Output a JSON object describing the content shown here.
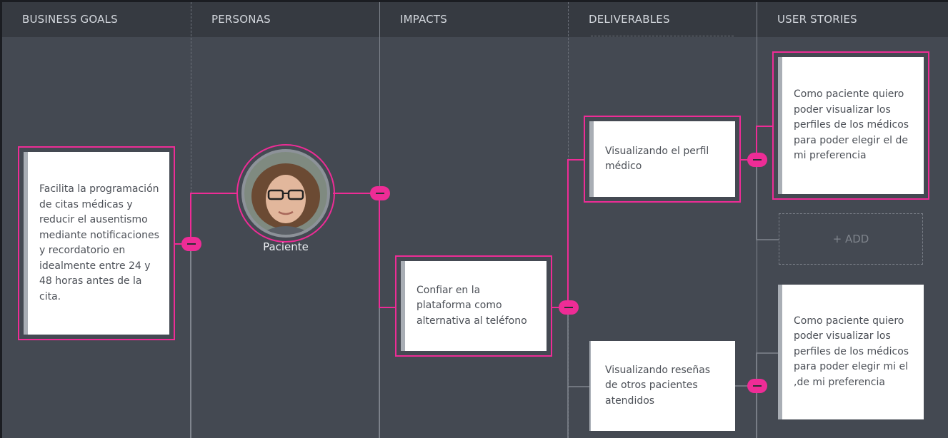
{
  "columns": [
    "BUSINESS GOALS",
    "PERSONAS",
    "IMPACTS",
    "DELIVERABLES",
    "USER STORIES"
  ],
  "business_goal": {
    "text": "Facilita la programación de citas médicas y reducir el ausentismo mediante notificaciones y recordatorio en idealmente entre 24 y 48 horas antes de la cita."
  },
  "persona": {
    "name": "Paciente",
    "avatar_icon": "person-photo"
  },
  "impact": {
    "text": "Confiar en la plataforma como alternativa al teléfono"
  },
  "deliverables": [
    {
      "text": "Visualizando el perfil médico"
    },
    {
      "text": "Visualizando reseñas de otros pacientes atendidos"
    }
  ],
  "user_stories": [
    {
      "text": "Como paciente quiero poder visualizar los perfiles de los médicos para poder elegir el de mi preferencia"
    },
    {
      "text": "Como  paciente quiero poder visualizar los perfiles de los  médicos para poder elegir mi el ,de mi preferencia"
    }
  ],
  "add_label": "+ ADD",
  "colors": {
    "accent": "#ee2c96",
    "board_bg": "#444952",
    "header_bg": "#363a41",
    "card_bg": "#ffffff"
  }
}
